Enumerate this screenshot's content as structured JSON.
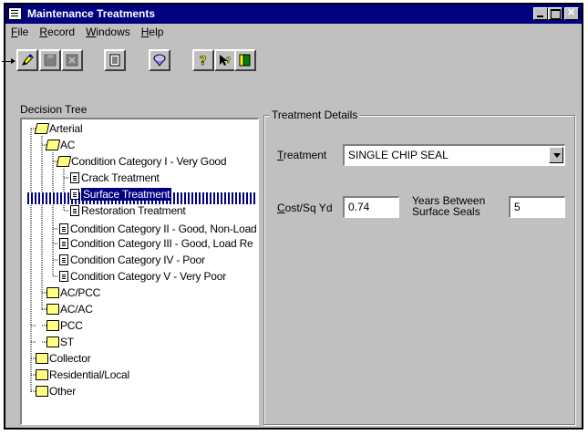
{
  "window": {
    "title": "Maintenance Treatments"
  },
  "menu": [
    "File",
    "Record",
    "Windows",
    "Help"
  ],
  "toolbar": {
    "buttons": [
      "edit-pencil-icon",
      "save-icon",
      "cancel-icon",
      "notes-icon",
      "filter-icon",
      "help-icon",
      "context-help-icon",
      "exit-door-icon"
    ]
  },
  "tree": {
    "label": "Decision Tree",
    "nodes": [
      "Arterial",
      "AC",
      "Condition Category I - Very Good",
      "Crack Treatment",
      "Surface Treatment",
      "Restoration Treatment",
      "Condition Category II - Good, Non-Load",
      "Condition Category III - Good, Load Re",
      "Condition Category IV - Poor",
      "Condition Category V - Very Poor",
      "AC/PCC",
      "AC/AC",
      "PCC",
      "ST",
      "Collector",
      "Residential/Local",
      "Other"
    ],
    "selected": "Surface Treatment"
  },
  "details": {
    "legend": "Treatment Details",
    "treatment_label": "Treatment",
    "treatment_value": "SINGLE CHIP SEAL",
    "cost_label": "Cost/Sq Yd",
    "cost_value": "0.74",
    "years_label_1": "Years Between",
    "years_label_2": "Surface Seals",
    "years_value": "5"
  },
  "colors": {
    "titlebar": "#000080",
    "face": "#c0c0c0",
    "selection": "#000080",
    "folder": "#ffff80"
  }
}
